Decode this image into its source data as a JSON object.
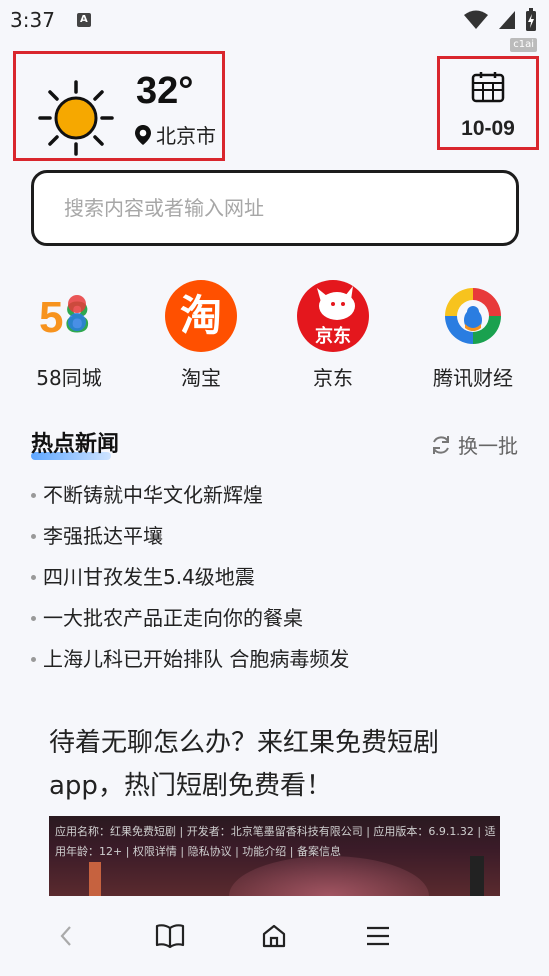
{
  "status_bar": {
    "time": "3:37",
    "notif_letter": "A"
  },
  "watermark": "c1ai",
  "weather": {
    "temperature": "32°",
    "city": "北京市"
  },
  "calendar": {
    "date": "10-09"
  },
  "search": {
    "placeholder": "搜索内容或者输入网址"
  },
  "shortcuts": [
    {
      "label": "58同城",
      "icon": "58-logo-icon"
    },
    {
      "label": "淘宝",
      "icon": "taobao-logo-icon",
      "logo_text": "淘"
    },
    {
      "label": "京东",
      "icon": "jd-logo-icon",
      "logo_text": "京东"
    },
    {
      "label": "腾讯财经",
      "icon": "tencent-finance-logo-icon"
    }
  ],
  "hot_news": {
    "title": "热点新闻",
    "refresh_label": "换一批",
    "items": [
      "不断铸就中华文化新辉煌",
      "李强抵达平壤",
      "四川甘孜发生5.4级地震",
      "一大批农产品正走向你的餐桌",
      "上海儿科已开始排队 合胞病毒频发"
    ]
  },
  "ad": {
    "title": "待着无聊怎么办？来红果免费短剧app，热门短剧免费看！",
    "info": "应用名称：红果免费短剧 | 开发者：北京笔墨留香科技有限公司 | 应用版本：6.9.1.32 | 适用年龄：12+ | 权限详情 | 隐私协议 | 功能介绍 | 备案信息"
  },
  "colors": {
    "accent_red": "#d9262d",
    "sun": "#f6a800"
  },
  "logo_58": {
    "digit1": "5",
    "digit2": "8"
  }
}
